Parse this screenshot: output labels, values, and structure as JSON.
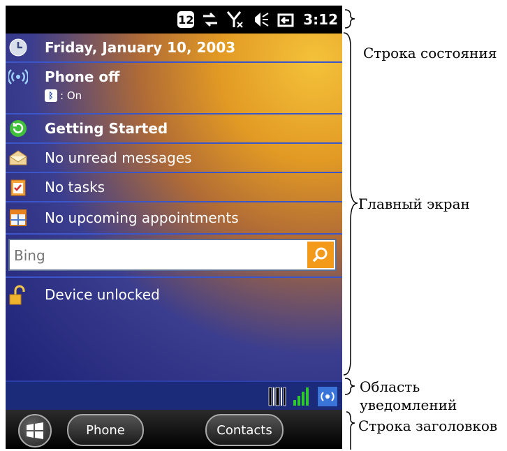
{
  "status_bar": {
    "badge": "12",
    "time": "3:12"
  },
  "today": {
    "date": "Friday, January 10, 2003",
    "phone": {
      "title": "Phone off",
      "bluetooth_state": ": On"
    },
    "getting_started": "Getting Started",
    "messages": "No unread messages",
    "tasks": "No tasks",
    "appointments": "No upcoming appointments",
    "search": {
      "placeholder": "Bing"
    },
    "device": "Device unlocked"
  },
  "taskbar": {
    "left_softkey": "Phone",
    "right_softkey": "Contacts"
  },
  "annotations": {
    "status_bar": "Строка состояния",
    "home_screen": "Главный экран",
    "notification_area_1": "Область",
    "notification_area_2": "уведомлений",
    "title_bar": "Строка заголовков"
  }
}
